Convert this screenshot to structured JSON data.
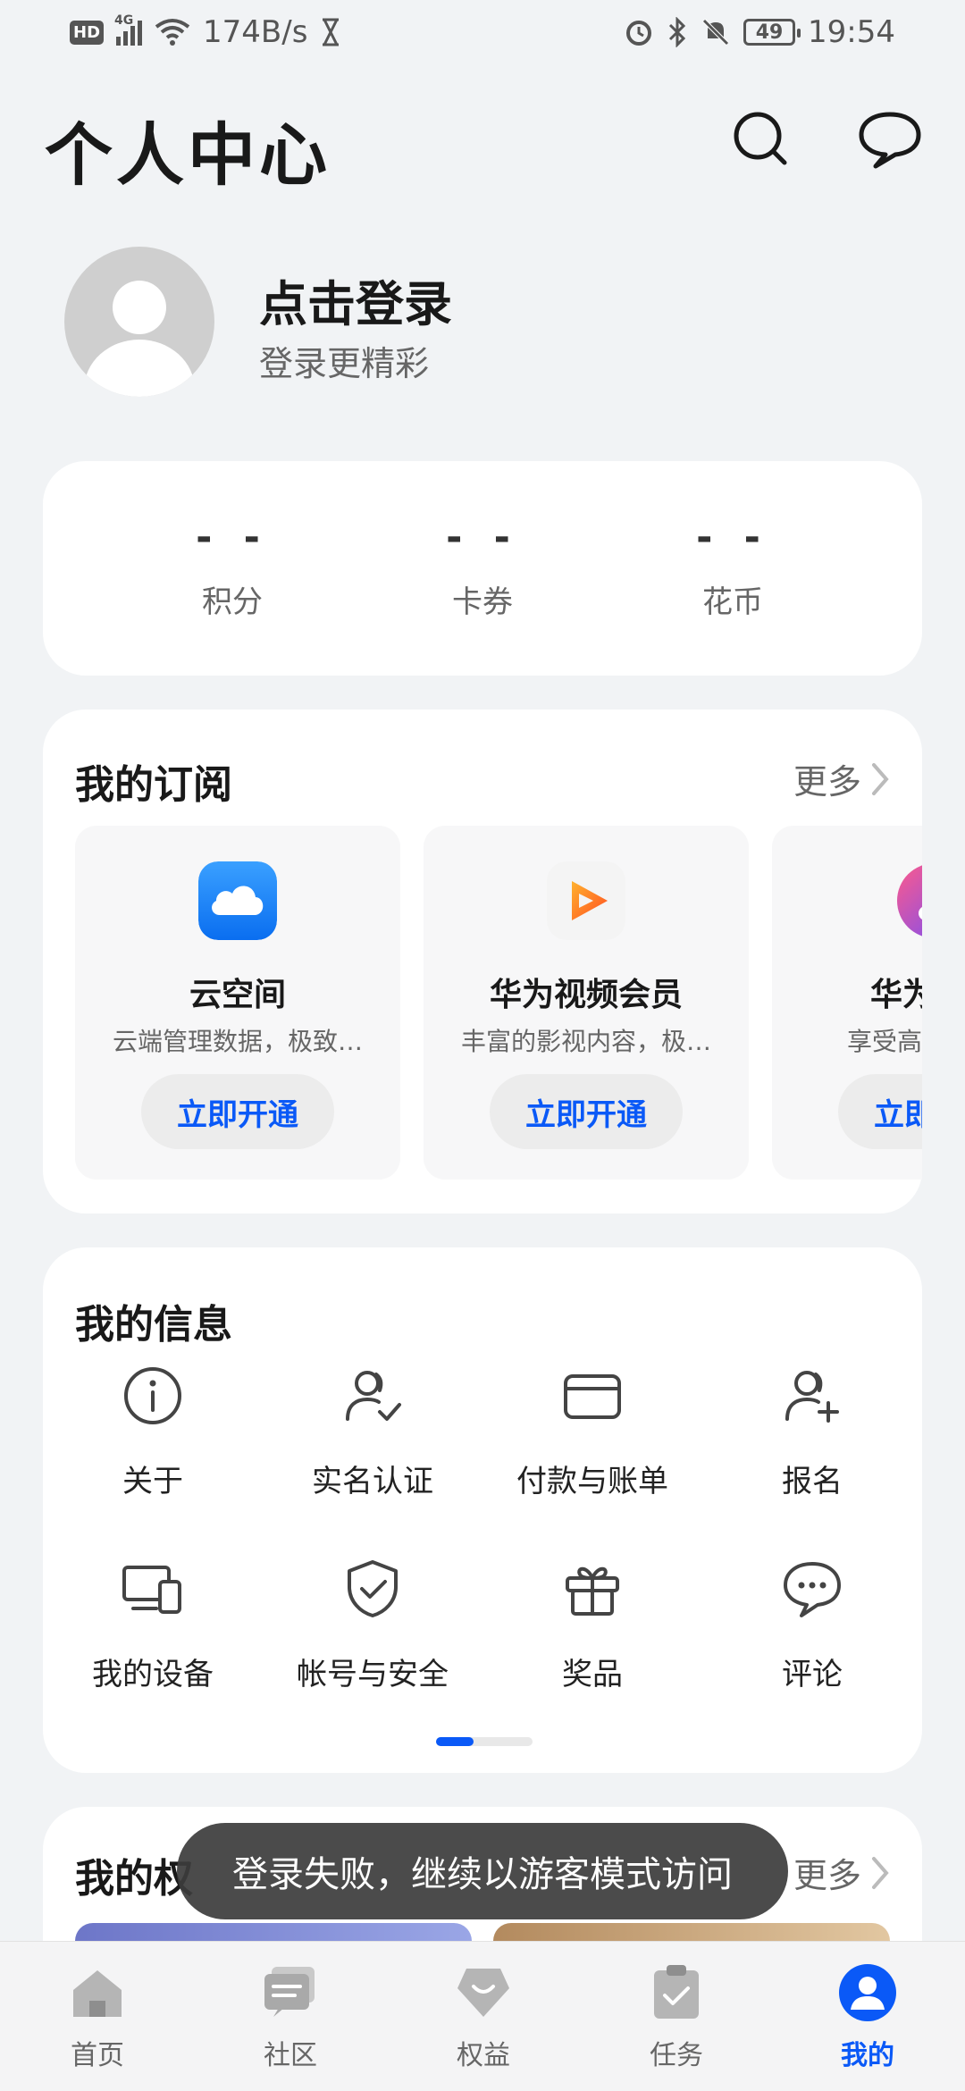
{
  "status_bar": {
    "hd": "HD",
    "net": "4G",
    "speed": "174B/s",
    "battery": "49",
    "time": "19:54"
  },
  "header": {
    "title": "个人中心",
    "icons": [
      "search-icon",
      "message-icon"
    ]
  },
  "profile": {
    "login_title": "点击登录",
    "login_subtitle": "登录更精彩"
  },
  "stats": [
    {
      "value": "- -",
      "label": "积分"
    },
    {
      "value": "- -",
      "label": "卡券"
    },
    {
      "value": "- -",
      "label": "花币"
    }
  ],
  "subscriptions": {
    "title": "我的订阅",
    "more": "更多",
    "items": [
      {
        "name": "云空间",
        "desc": "云端管理数据，极致…",
        "button": "立即开通",
        "icon": "cloud-icon"
      },
      {
        "name": "华为视频会员",
        "desc": "丰富的影视内容，极…",
        "button": "立即开通",
        "icon": "video-play-icon"
      },
      {
        "name": "华为音乐",
        "desc": "享受高品质音乐",
        "button": "立即开通",
        "icon": "music-icon"
      }
    ]
  },
  "my_info": {
    "title": "我的信息",
    "items": [
      {
        "label": "关于",
        "icon": "info-icon"
      },
      {
        "label": "实名认证",
        "icon": "verified-user-icon"
      },
      {
        "label": "付款与账单",
        "icon": "card-icon"
      },
      {
        "label": "报名",
        "icon": "add-user-icon"
      },
      {
        "label": "我的设备",
        "icon": "devices-icon"
      },
      {
        "label": "帐号与安全",
        "icon": "shield-check-icon"
      },
      {
        "label": "奖品",
        "icon": "gift-icon"
      },
      {
        "label": "评论",
        "icon": "comment-icon"
      }
    ],
    "page_index": 1,
    "page_count": 2
  },
  "rights": {
    "title_visible": "我的权",
    "more": "更多"
  },
  "toast": "登录失败，继续以游客模式访问",
  "tabbar": [
    {
      "label": "首页",
      "icon": "home-icon",
      "active": false
    },
    {
      "label": "社区",
      "icon": "community-icon",
      "active": false
    },
    {
      "label": "权益",
      "icon": "rights-icon",
      "active": false
    },
    {
      "label": "任务",
      "icon": "task-icon",
      "active": false
    },
    {
      "label": "我的",
      "icon": "profile-icon",
      "active": true
    }
  ],
  "colors": {
    "accent": "#0a59f7",
    "background": "#f1f3f5",
    "card": "#ffffff"
  }
}
